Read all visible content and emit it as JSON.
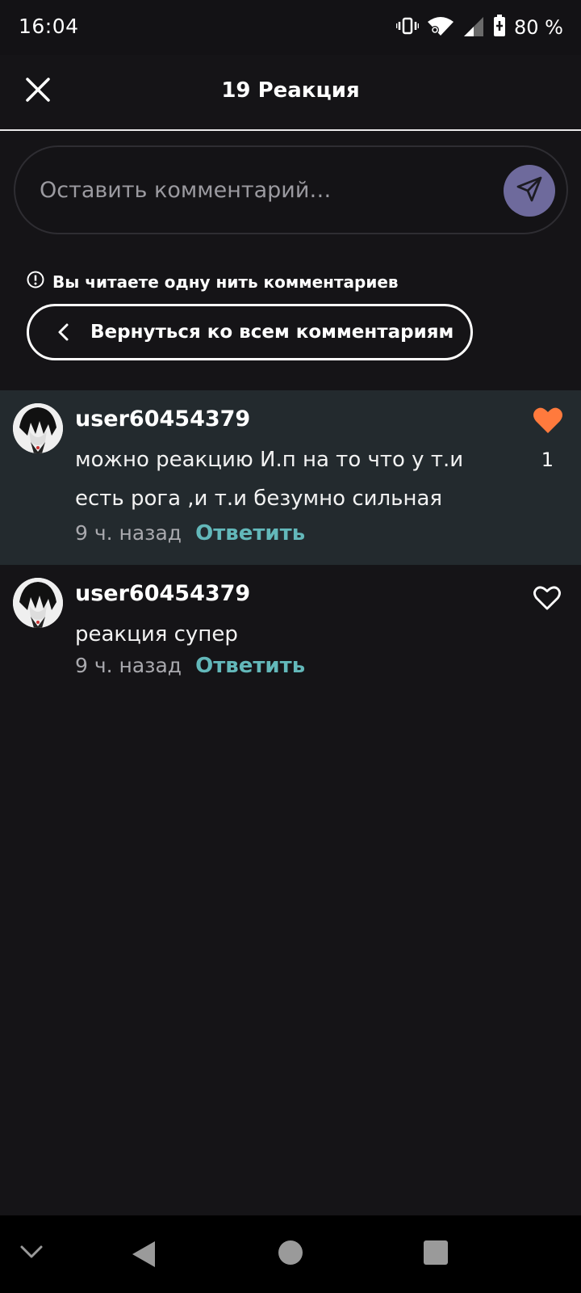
{
  "status_bar": {
    "time": "16:04",
    "battery_text": "80 %",
    "icons": [
      "vibrate-icon",
      "wifi-icon",
      "signal-icon",
      "battery-icon"
    ]
  },
  "header": {
    "title": "19 Реакция",
    "close_icon": "close-icon"
  },
  "comment_input": {
    "placeholder": "Оставить комментарий…",
    "send_icon": "send-icon",
    "send_color": "#6e6a9c"
  },
  "thread": {
    "notice": "Вы читаете одну нить комментариев",
    "back_label": "Вернуться ко всем комментариям"
  },
  "comments": [
    {
      "username": "user60454379",
      "text_line1": "можно реакцию И.п на то что  у т.и",
      "text_line2": "есть рога ,и  т.и безумно сильная",
      "time": "9 ч. назад",
      "reply_label": "Ответить",
      "liked": true,
      "like_count": "1"
    },
    {
      "username": "user60454379",
      "text_line1": "реакция супер",
      "time": "9 ч. назад",
      "reply_label": "Ответить",
      "liked": false
    }
  ],
  "colors": {
    "background": "#151417",
    "highlight": "#232a2e",
    "accent_reply": "#63b8ba",
    "like_active": "#ff7a3d"
  },
  "nav_bar": {
    "icons": [
      "chevron-down-icon",
      "back-icon",
      "home-icon",
      "recents-icon"
    ]
  }
}
